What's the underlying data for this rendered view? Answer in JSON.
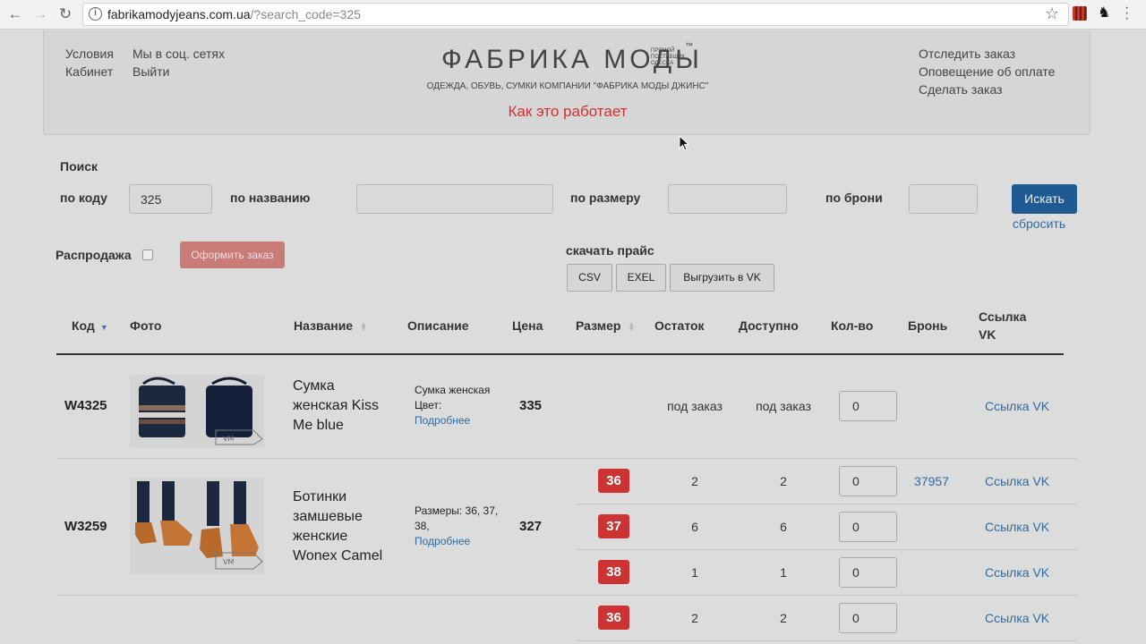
{
  "browser": {
    "url_host": "fabrikamodyjeans.com.ua",
    "url_path": "/?search_code=325"
  },
  "header": {
    "left_links": [
      "Условия",
      "Мы в соц. сетях",
      "Кабинет",
      "Выйти"
    ],
    "logo_text": "ФАБРИКА МОДЫ",
    "logo_small": "ПРЯМОЙ ПОСТАВЩИК ОДЕССА",
    "logo_tm": "™",
    "tagline": "ОДЕЖДА, ОБУВЬ, СУМКИ КОМПАНИИ \"ФАБРИКА МОДЫ ДЖИНС\"",
    "how_it_works": "Как это работает",
    "right_links": [
      "Отследить заказ",
      "Оповещение об оплате",
      "Сделать заказ"
    ]
  },
  "search": {
    "title": "Поиск",
    "by_code_label": "по коду",
    "by_code_value": "325",
    "by_name_label": "по названию",
    "by_name_value": "",
    "by_size_label": "по размеру",
    "by_size_value": "",
    "by_reservation_label": "по брони",
    "by_reservation_value": "",
    "search_button": "Искать",
    "reset_link": "сбросить"
  },
  "controls": {
    "sale_label": "Распродажа",
    "sale_checked": false,
    "order_button": "Оформить заказ",
    "download_label": "скачать прайс",
    "csv_button": "CSV",
    "excel_button": "EXEL",
    "vk_button": "Выгрузить в VK"
  },
  "table": {
    "headers": [
      "Код",
      "Фото",
      "Название",
      "Описание",
      "Цена",
      "Размер",
      "Остаток",
      "Доступно",
      "Кол-во",
      "Бронь",
      "Ссылка VK"
    ],
    "products": [
      {
        "code": "W4325",
        "name": "Сумка женская Kiss Me blue",
        "desc_lines": [
          "Сумка женская",
          "Цвет:"
        ],
        "more": "Подробнее",
        "price": "335",
        "rows": [
          {
            "size": "",
            "stock": "под заказ",
            "available": "под заказ",
            "qty": "0",
            "reservation": "",
            "vk": "Ссылка VK"
          }
        ]
      },
      {
        "code": "W3259",
        "name": "Ботинки замшевые женские Wonex Camel",
        "desc_lines": [
          "Размеры: 36, 37,",
          "38,"
        ],
        "more": "Подробнее",
        "price": "327",
        "rows": [
          {
            "size": "36",
            "stock": "2",
            "available": "2",
            "qty": "0",
            "reservation": "37957",
            "vk": "Ссылка VK"
          },
          {
            "size": "37",
            "stock": "6",
            "available": "6",
            "qty": "0",
            "reservation": "",
            "vk": "Ссылка VK"
          },
          {
            "size": "38",
            "stock": "1",
            "available": "1",
            "qty": "0",
            "reservation": "",
            "vk": "Ссылка VK"
          }
        ]
      },
      {
        "code": "",
        "name": "",
        "rows": [
          {
            "size": "36",
            "stock": "2",
            "available": "2",
            "qty": "0",
            "reservation": "",
            "vk": "Ссылка VK"
          }
        ]
      }
    ]
  },
  "colors": {
    "accent_red": "#cc3333",
    "link_blue": "#2f6aa0",
    "primary_button": "#1f5a93"
  }
}
